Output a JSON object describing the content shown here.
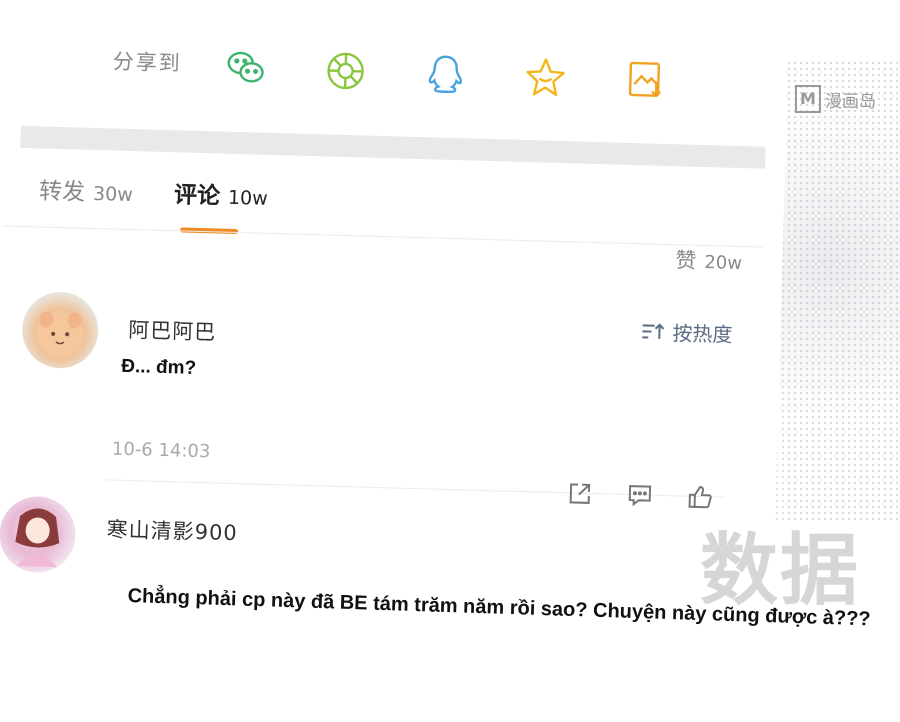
{
  "share": {
    "label": "分享到",
    "icons": [
      "wechat-icon",
      "moments-icon",
      "qq-icon",
      "favorite-star-icon",
      "save-image-icon"
    ],
    "colors": {
      "wechat": "#3cb46e",
      "moments": "#8cc63f",
      "qq": "#4aa3df",
      "star": "#f3b51b",
      "save": "#f0a31f"
    }
  },
  "tabs": {
    "repost": {
      "label": "转发",
      "count": "30w"
    },
    "comment": {
      "label": "评论",
      "count": "10w"
    },
    "likes": {
      "label": "赞",
      "count": "20w"
    },
    "accent_color": "#f08a24"
  },
  "sort": {
    "label": "按热度"
  },
  "comments": [
    {
      "user": "阿巴阿巴",
      "text": "Đ... đm?",
      "time": "10-6 14:03"
    },
    {
      "user": "寒山清影900",
      "text": "Chẳng phải cp này đã BE tám trăm năm rồi sao? Chuyện này cũng được à???"
    }
  ],
  "watermark": {
    "brand_m": "M",
    "brand_text": "漫画岛",
    "big_text": "数据"
  }
}
